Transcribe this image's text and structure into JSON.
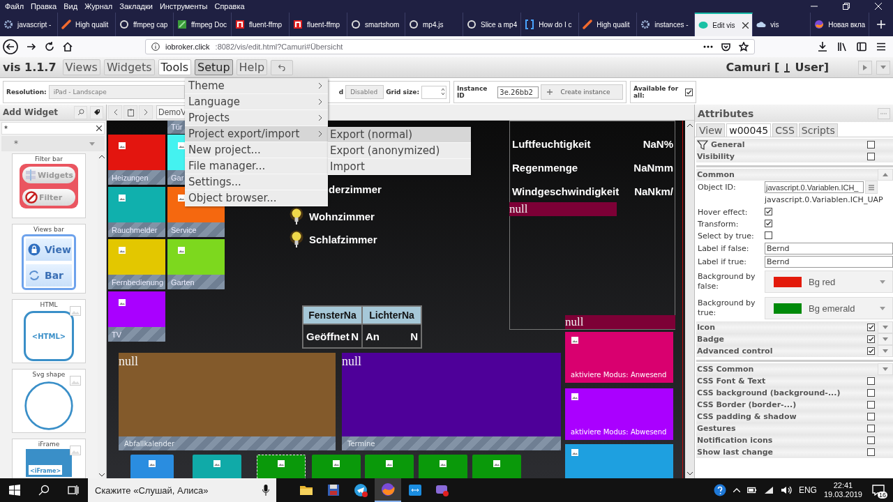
{
  "browser": {
    "menu": [
      "Файл",
      "Правка",
      "Вид",
      "Журнал",
      "Закладки",
      "Инструменты",
      "Справка"
    ],
    "tabs": [
      {
        "title": "javascript -",
        "selected": false
      },
      {
        "title": "High qualit",
        "selected": false
      },
      {
        "title": "ffmpeg cap",
        "selected": false
      },
      {
        "title": "ffmpeg Doc",
        "selected": false
      },
      {
        "title": "fluent-ffmp",
        "selected": false
      },
      {
        "title": "fluent-ffmp",
        "selected": false
      },
      {
        "title": "smartshom",
        "selected": false
      },
      {
        "title": "mp4.js",
        "selected": false
      },
      {
        "title": "Slice a mp4",
        "selected": false
      },
      {
        "title": "How do I c",
        "selected": false
      },
      {
        "title": "High qualit",
        "selected": false
      },
      {
        "title": "instances -",
        "selected": false
      },
      {
        "title": "Edit vis",
        "selected": true
      },
      {
        "title": "vis",
        "selected": false
      },
      {
        "title": "Новая вкла",
        "selected": false
      }
    ],
    "url_host": "iobroker.click",
    "url_path": ":8082/vis/edit.html?Camuri#Übersicht"
  },
  "app": {
    "version": "vis 1.1.7",
    "tabs": [
      {
        "label": "Views",
        "selected": false,
        "open": false
      },
      {
        "label": "Widgets",
        "selected": false,
        "open": false
      },
      {
        "label": "Tools",
        "selected": true,
        "open": false
      },
      {
        "label": "Setup",
        "selected": false,
        "open": true
      },
      {
        "label": "Help",
        "selected": false,
        "open": false
      }
    ],
    "project": "Camuri [",
    "user": "User]"
  },
  "toolbar": {
    "resolution_label": "Resolution:",
    "resolution": "iPad - Landscape",
    "cut_label": "d",
    "snapping": "Disabled",
    "grid_label": "Grid size:",
    "instance_label": "Instance ID",
    "instance_id": "3e.26bb2",
    "create_button": "Create instance",
    "available_label": "Available for all:",
    "available": true
  },
  "menu": {
    "items": [
      {
        "label": "Theme",
        "submenu": true,
        "selected": false
      },
      {
        "label": "Language",
        "submenu": true,
        "selected": false
      },
      {
        "label": "Projects",
        "submenu": true,
        "selected": false
      },
      {
        "label": "Project export/import",
        "submenu": true,
        "selected": true
      },
      {
        "label": "New project...",
        "submenu": false,
        "selected": false
      },
      {
        "label": "File manager...",
        "submenu": false,
        "selected": false
      },
      {
        "label": "Settings...",
        "submenu": false,
        "selected": false
      },
      {
        "label": "Object browser...",
        "submenu": false,
        "selected": false
      }
    ],
    "submenu": [
      {
        "label": "Export (normal)",
        "selected": true
      },
      {
        "label": "Export (anonymized)",
        "selected": false
      },
      {
        "label": "Import",
        "selected": false
      }
    ]
  },
  "palette": {
    "title": "Add Widget",
    "filter": "*",
    "category": "*",
    "widgets": [
      {
        "kind": "filter-bar",
        "title": "Filter bar",
        "texts": [
          "Widgets",
          "Filter"
        ]
      },
      {
        "kind": "views-bar",
        "title": "Views bar",
        "texts": [
          "View",
          "Bar"
        ]
      },
      {
        "kind": "html",
        "title": "HTML",
        "texts": [
          "<HTML>"
        ]
      },
      {
        "kind": "svg",
        "title": "Svg shape"
      },
      {
        "kind": "iframe",
        "title": "iFrame",
        "texts": [
          "<iFrame>"
        ]
      }
    ]
  },
  "view_tab": "DemoV",
  "canvas": {
    "tiles": [
      {
        "kind": "bar",
        "label": "Tür"
      },
      {
        "kind": "tile",
        "label": "Heizungen",
        "color": "#e3150f"
      },
      {
        "kind": "tile",
        "label": "Gar",
        "color": "#44f2f0"
      },
      {
        "kind": "tile",
        "label": "Rauchmelder",
        "color": "#10b0ad"
      },
      {
        "kind": "tile",
        "label": "Service",
        "color": "#f5680f"
      },
      {
        "kind": "tile",
        "label": "Fernbedienung",
        "color": "#e3c700"
      },
      {
        "kind": "tile",
        "label": "Garten",
        "color": "#7dd81e"
      },
      {
        "kind": "tile",
        "label": "TV",
        "color": "#a900ff"
      }
    ],
    "lights": [
      {
        "kind": "text",
        "label": "derzimmer"
      },
      {
        "kind": "lamp",
        "label": "Wohnzimmer"
      },
      {
        "kind": "lamp",
        "label": "Schlafzimmer"
      }
    ],
    "weather": [
      {
        "label": "Luftfeuchtigkeit",
        "value": "NaN%"
      },
      {
        "label": "Regenmenge",
        "value": "NaNmm"
      },
      {
        "label": "Windgeschwindigkeit",
        "value": "NaNkm/"
      }
    ],
    "null_bars": [
      "null",
      "null"
    ],
    "table": {
      "columns": [
        "FensterNa",
        "LichterNa"
      ],
      "cells": [
        {
          "text": "Geöffnet",
          "value": "N"
        },
        {
          "text": "An",
          "value": "N"
        }
      ]
    },
    "panels": [
      {
        "text": "null",
        "label": "Abfallkalender",
        "color": "#835a2b"
      },
      {
        "text": "null",
        "label": "Termine",
        "color": "#4e0099"
      }
    ],
    "mode_buttons": [
      {
        "label": "aktiviere Modus: Anwesend",
        "color": "#d9006f"
      },
      {
        "label": "aktiviere Modus: Abwesend",
        "color": "#aa00ff"
      },
      {
        "color": "#1ea0e0"
      }
    ],
    "footer_tiles": [
      {
        "color": "#2a8de0",
        "selected": false
      },
      {
        "color": "#10aaa8",
        "selected": false
      },
      {
        "color": "#0a990a",
        "selected": true
      },
      {
        "color": "#0a990a",
        "selected": false
      },
      {
        "color": "#0a990a",
        "selected": false
      },
      {
        "color": "#0a990a",
        "selected": false
      },
      {
        "color": "#0a990a",
        "selected": false
      }
    ]
  },
  "attributes": {
    "title": "Attributes",
    "tabs": [
      {
        "label": "View",
        "selected": false
      },
      {
        "label": "w00045",
        "selected": true
      },
      {
        "label": "CSS",
        "selected": false
      },
      {
        "label": "Scripts",
        "selected": false
      }
    ],
    "rows": [
      {
        "kind": "filter",
        "label": "General",
        "checked": false
      },
      {
        "kind": "group",
        "label": "Visibility",
        "checked": false
      },
      {
        "kind": "section",
        "label": "Common",
        "expanded": true
      },
      {
        "kind": "object-id",
        "label": "Object ID:",
        "value": "javascript.0.Variablen.ICH_",
        "note": "javascript.0.Variablen.ICH_UAP"
      },
      {
        "kind": "check",
        "label": "Hover effect:",
        "checked": true
      },
      {
        "kind": "check",
        "label": "Transform:",
        "checked": true
      },
      {
        "kind": "check",
        "label": "Select by true:",
        "checked": false
      },
      {
        "kind": "input",
        "label": "Label if false:",
        "value": "Bernd"
      },
      {
        "kind": "input",
        "label": "Label if true:",
        "value": "Bernd"
      },
      {
        "kind": "color",
        "label": "Background by false:",
        "value": "Bg red",
        "color": "#e31a0b"
      },
      {
        "kind": "color",
        "label": "Background by true:",
        "value": "Bg emerald",
        "color": "#008a0a"
      },
      {
        "kind": "group",
        "label": "Icon",
        "checked": true,
        "expanded": false
      },
      {
        "kind": "group",
        "label": "Badge",
        "checked": true,
        "expanded": false
      },
      {
        "kind": "group",
        "label": "Advanced control",
        "checked": true,
        "expanded": false
      },
      {
        "kind": "section",
        "label": "CSS Common",
        "expanded": false
      },
      {
        "kind": "group",
        "label": "CSS Font & Text",
        "checked": false
      },
      {
        "kind": "group",
        "label": "CSS background (background-...)",
        "checked": false
      },
      {
        "kind": "group",
        "label": "CSS Border (border-...)",
        "checked": false
      },
      {
        "kind": "group",
        "label": "CSS padding & shadow",
        "checked": false
      },
      {
        "kind": "group",
        "label": "Gestures",
        "checked": false
      },
      {
        "kind": "group",
        "label": "Notification icons",
        "checked": false
      },
      {
        "kind": "group",
        "label": "Show last change",
        "checked": false
      }
    ]
  },
  "taskbar": {
    "search": "Скажите «Слушай, Алиса»",
    "apps": [
      {
        "selected": false
      },
      {
        "selected": false
      },
      {
        "selected": false
      },
      {
        "selected": true
      },
      {
        "selected": false
      },
      {
        "selected": false
      }
    ],
    "language": "ENG",
    "time": "22:41",
    "date": "19.03.2019",
    "notifications": "16"
  }
}
